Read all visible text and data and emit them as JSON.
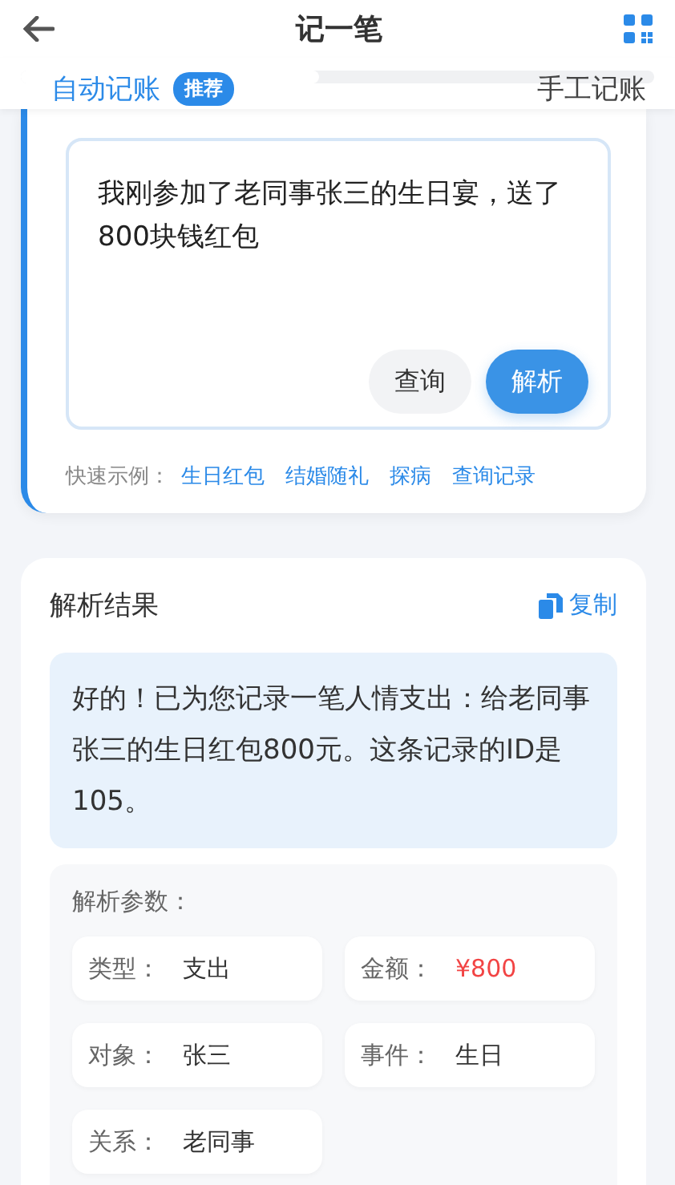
{
  "header": {
    "title": "记一笔"
  },
  "tabs": [
    {
      "label": "自动记账",
      "badge": "推荐",
      "selected": true
    },
    {
      "label": "手工记账",
      "selected": false
    }
  ],
  "input": {
    "value": "我刚参加了老同事张三的生日宴，送了800块钱红包"
  },
  "buttons": [
    {
      "label": "查询",
      "kind": "secondary"
    },
    {
      "label": "解析",
      "kind": "primary"
    }
  ],
  "examples": {
    "label": "快速示例：",
    "items": [
      "生日红包",
      "结婚随礼",
      "探病",
      "查询记录"
    ]
  },
  "result": {
    "title": "解析结果",
    "copy": "复制",
    "message": "好的！已为您记录一笔人情支出：给老同事张三的生日红包800元。这条记录的ID是105。",
    "params_title": "解析参数：",
    "params": [
      {
        "label": "类型：",
        "value": "支出",
        "highlight": false
      },
      {
        "label": "金额：",
        "value": "¥800",
        "highlight": true
      },
      {
        "label": "对象：",
        "value": "张三",
        "highlight": false
      },
      {
        "label": "事件：",
        "value": "生日",
        "highlight": false
      },
      {
        "label": "关系：",
        "value": "老同事",
        "highlight": false
      }
    ]
  }
}
